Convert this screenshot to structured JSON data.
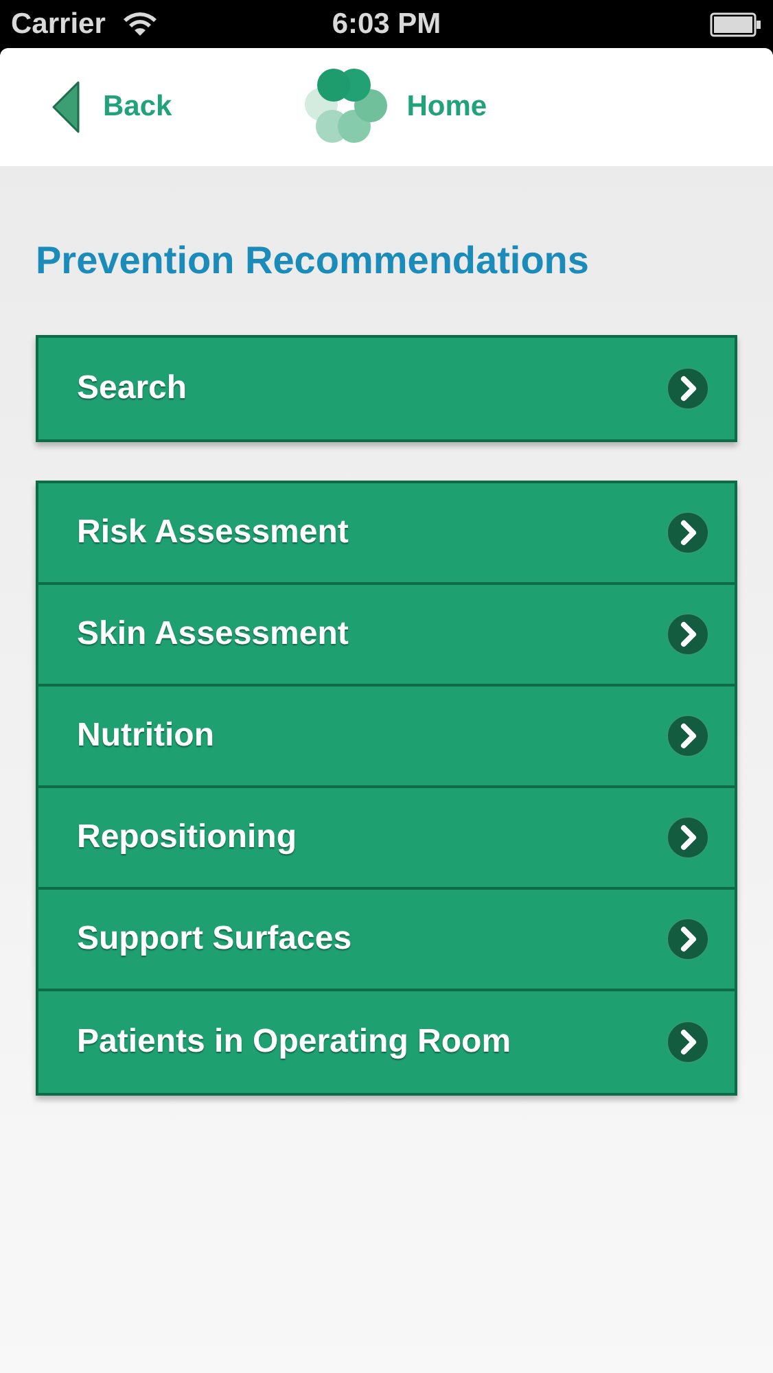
{
  "status_bar": {
    "carrier": "Carrier",
    "time": "6:03 PM"
  },
  "nav": {
    "back": "Back",
    "home": "Home"
  },
  "title": "Prevention Recommendations",
  "search": {
    "label": "Search"
  },
  "menu": [
    {
      "label": "Risk Assessment"
    },
    {
      "label": "Skin Assessment"
    },
    {
      "label": "Nutrition"
    },
    {
      "label": "Repositioning"
    },
    {
      "label": "Support Surfaces"
    },
    {
      "label": "Patients in Operating Room"
    }
  ]
}
